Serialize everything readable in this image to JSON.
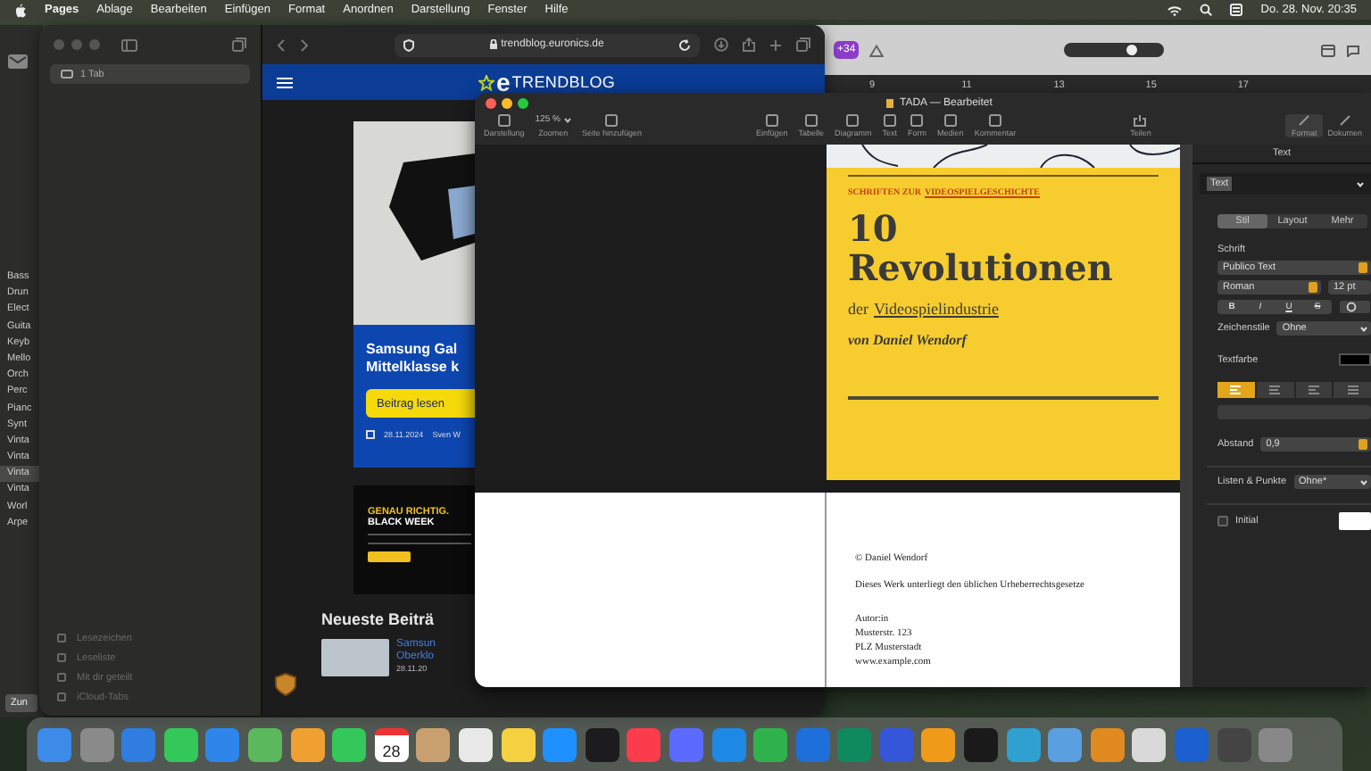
{
  "menu_bar": {
    "app": "Pages",
    "items": [
      "Ablage",
      "Bearbeiten",
      "Einfügen",
      "Format",
      "Anordnen",
      "Darstellung",
      "Fenster",
      "Hilfe"
    ],
    "clock": "Do. 28. Nov. 20:35"
  },
  "background_window": {
    "list": [
      {
        "label": "Bass",
        "selected": false
      },
      {
        "label": "Drun",
        "selected": false
      },
      {
        "label": "Elect",
        "selected": false
      },
      {
        "label": "Guita",
        "selected": false
      },
      {
        "label": "Keyb",
        "selected": false
      },
      {
        "label": "Mello",
        "selected": false
      },
      {
        "label": "Orch",
        "selected": false
      },
      {
        "label": "Perc",
        "selected": false
      },
      {
        "label": "Pianc",
        "selected": false
      },
      {
        "label": "Synt",
        "selected": false
      },
      {
        "label": "Vinta",
        "selected": false
      },
      {
        "label": "Vinta",
        "selected": false
      },
      {
        "label": "Vinta",
        "selected": true
      },
      {
        "label": "Vinta",
        "selected": false
      },
      {
        "label": "Worl",
        "selected": false
      },
      {
        "label": "Arpe",
        "selected": false
      }
    ],
    "footer_button": "Zun"
  },
  "back_window": {
    "badge": "+34",
    "slider": {
      "level": 0.68
    },
    "ruler": [
      "9",
      "11",
      "13",
      "15",
      "17"
    ]
  },
  "safari": {
    "sidebar": {
      "tabs": [
        {
          "label": "1 Tab",
          "selected": true
        }
      ],
      "links": [
        "Lesezeichen",
        "Leseliste",
        "Mit dir geteilt",
        "iCloud-Tabs"
      ]
    },
    "url": "trendblog.euronics.de",
    "site": {
      "logo_mark": "e",
      "logo": "TRENDBLOG",
      "hero": {
        "title_lines": [
          "Samsung Gal",
          "Mittelklasse k"
        ],
        "button": "Beitrag lesen",
        "date": "28.11.2024",
        "author": "Sven W"
      },
      "ad": {
        "headline": "GENAU RICHTIG.",
        "subhead": "BLACK WEEK"
      },
      "section": "Neueste Beiträ",
      "article": {
        "title_lines": [
          "Samsun",
          "Oberklo"
        ],
        "date": "28.11.20"
      }
    }
  },
  "pages": {
    "title": "TADA — Bearbeitet",
    "toolbar_left": [
      {
        "label": "Darstellung",
        "kind": "icon"
      },
      {
        "label": "Zoomen",
        "kind": "zoom",
        "value": "125 %"
      },
      {
        "label": "Seite hinzufügen",
        "kind": "icon"
      }
    ],
    "toolbar_center": [
      "Einfügen",
      "Tabelle",
      "Diagramm",
      "Text",
      "Form",
      "Medien",
      "Kommentar"
    ],
    "share": "Teilen",
    "toolbar_right": [
      {
        "label": "Format",
        "selected": true
      },
      {
        "label": "Dokumen",
        "selected": false
      }
    ],
    "cover": {
      "series_prefix": "SCHRIFTEN ZUR",
      "series_link": "VIDEOSPIELGESCHICHTE",
      "title_lines": [
        "10",
        "Revolutionen"
      ],
      "subtitle_prefix": "der",
      "subtitle_link": "Videospielindustrie",
      "author": "von Daniel Wendorf"
    },
    "imprint": {
      "copyright": "© Daniel Wendorf",
      "notice": "Dieses Werk unterliegt den üblichen Urheberrechtsgesetze",
      "address": [
        "Autor:in",
        "Musterstr. 123",
        "PLZ Musterstadt",
        "www.example.com"
      ]
    },
    "inspector": {
      "header": "Text",
      "style": "Text",
      "tabs": [
        {
          "label": "Stil",
          "selected": true
        },
        {
          "label": "Layout",
          "selected": false
        },
        {
          "label": "Mehr",
          "selected": false
        }
      ],
      "section": "Schrift",
      "font": "Publico Text",
      "typeface": "Roman",
      "size": "12 pt",
      "format_buttons": [
        "B",
        "I",
        "U",
        "S"
      ],
      "char_styles_label": "Zeichenstile",
      "char_styles": "Ohne",
      "color_label": "Textfarbe",
      "alignment": [
        {
          "selected": true
        },
        {
          "selected": false
        },
        {
          "selected": false
        },
        {
          "selected": false
        }
      ],
      "spacing_label": "Abstand",
      "spacing": "0,9",
      "lists_label": "Listen & Punkte",
      "lists": "Ohne*",
      "initial_label": "Initial",
      "initial_checked": false
    }
  },
  "dock": {
    "calendar_date": "28"
  }
}
